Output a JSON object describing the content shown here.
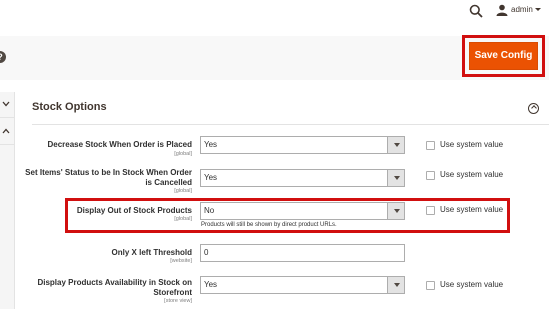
{
  "topbar": {
    "user_name": "admin"
  },
  "toolbar": {
    "save_label": "Save Config"
  },
  "section": {
    "title": "Stock Options"
  },
  "fields": [
    {
      "label": "Decrease Stock When Order is Placed",
      "scope": "[global]",
      "value": "Yes",
      "system_value_label": "Use system value"
    },
    {
      "label_line1": "Set Items' Status to be In Stock When Order",
      "label_line2": "is Cancelled",
      "scope": "[global]",
      "value": "Yes",
      "system_value_label": "Use system value"
    },
    {
      "label": "Display Out of Stock Products",
      "scope": "[global]",
      "value": "No",
      "note": "Products will still be shown by direct product URLs.",
      "system_value_label": "Use system value"
    },
    {
      "label": "Only X left Threshold",
      "scope": "[website]",
      "value": "0"
    },
    {
      "label_line1": "Display Products Availability in Stock on",
      "label_line2": "Storefront",
      "scope": "[store view]",
      "value": "Yes",
      "system_value_label": "Use system value"
    }
  ],
  "icons": {
    "search": "search-icon",
    "user": "user-icon",
    "help": "help-icon",
    "collapse": "collapse-icon"
  },
  "colors": {
    "primary_button": "#eb5202",
    "highlight": "#d10f0f",
    "text": "#303030"
  }
}
